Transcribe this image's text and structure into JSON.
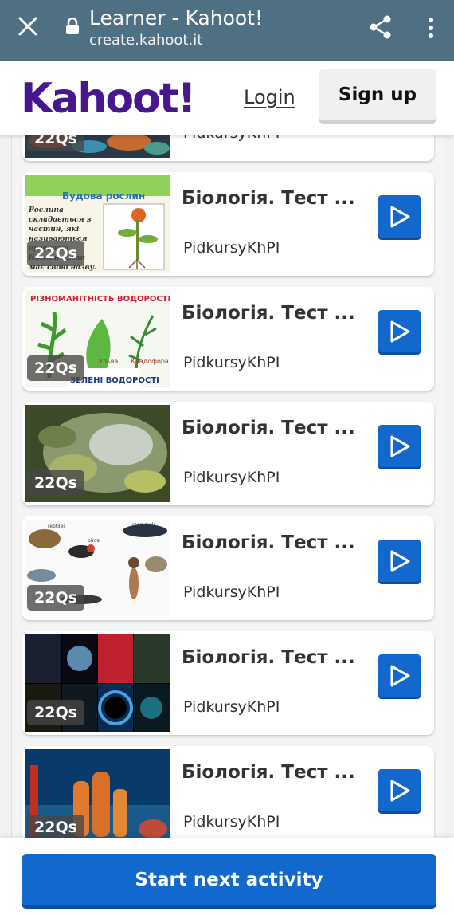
{
  "browser": {
    "title": "Learner - Kahoot!",
    "url": "create.kahoot.it"
  },
  "header": {
    "logo_text": "Kahoot!",
    "login_label": "Login",
    "signup_label": "Sign up"
  },
  "cards": [
    {
      "badge": "22Qs",
      "title": "",
      "author": "PidkursyKhPI",
      "thumb_text": []
    },
    {
      "badge": "22Qs",
      "title": "Біологія. Тест ...",
      "author": "PidkursyKhPI",
      "thumb_text": [
        "Будова рослин",
        "Рослина складається з частин, які називаються органами. Кожен орган має свою назву."
      ]
    },
    {
      "badge": "22Qs",
      "title": "Біологія. Тест ...",
      "author": "PidkursyKhPI",
      "thumb_text": [
        "РІЗНОМАНІТНІСТЬ ВОДОРОСТЕЙ",
        "Ульва",
        "Кладофора",
        "ЗЕЛЕНІ ВОДОРОСТІ"
      ]
    },
    {
      "badge": "22Qs",
      "title": "Біологія. Тест ...",
      "author": "PidkursyKhPI",
      "thumb_text": []
    },
    {
      "badge": "22Qs",
      "title": "Біологія. Тест ...",
      "author": "PidkursyKhPI",
      "thumb_text": [
        "reptiles",
        "birds",
        "mammals"
      ]
    },
    {
      "badge": "22Qs",
      "title": "Біологія. Тест ...",
      "author": "PidkursyKhPI",
      "thumb_text": []
    },
    {
      "badge": "22Qs",
      "title": "Біологія. Тест ...",
      "author": "PidkursyKhPI",
      "thumb_text": []
    }
  ],
  "footer": {
    "next_label": "Start next activity"
  },
  "colors": {
    "browser_bar": "#4f6f82",
    "brand_purple": "#46178f",
    "primary_blue": "#1368ce"
  },
  "icons": [
    "close-icon",
    "lock-icon",
    "share-icon",
    "more-vert-icon",
    "play-icon"
  ]
}
